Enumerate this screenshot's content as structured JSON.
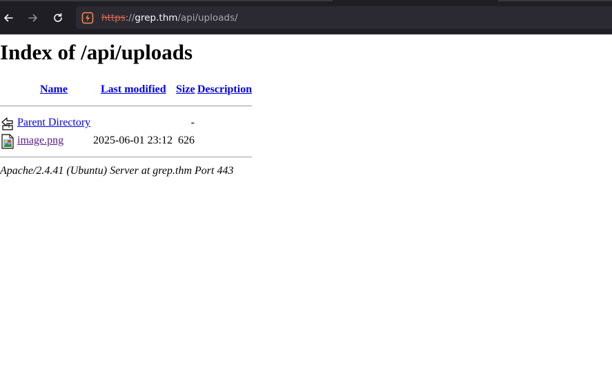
{
  "browser": {
    "url_scheme": "https",
    "url_separator": "://",
    "url_host": "grep.thm",
    "url_path": "/api/uploads/",
    "security_icon": "insecure-https-icon",
    "colors": {
      "chrome_bg": "#1f1e25",
      "urlbar_bg": "#2b2a33",
      "warning": "#ff5d43"
    }
  },
  "page": {
    "title": "Index of /api/uploads",
    "columns": {
      "name": "Name",
      "last_modified": "Last modified",
      "size": "Size",
      "description": "Description"
    },
    "rows": [
      {
        "icon": "back-folder-icon",
        "name": "Parent Directory",
        "modified": "",
        "size": "-",
        "description": ""
      },
      {
        "icon": "image-file-icon",
        "name": "image.png",
        "modified": "2025-06-01 23:12",
        "size": "626",
        "description": ""
      }
    ],
    "footer": "Apache/2.4.41 (Ubuntu) Server at grep.thm Port 443",
    "colors": {
      "link": "#0000ee",
      "visited_link": "#551a8b"
    }
  }
}
